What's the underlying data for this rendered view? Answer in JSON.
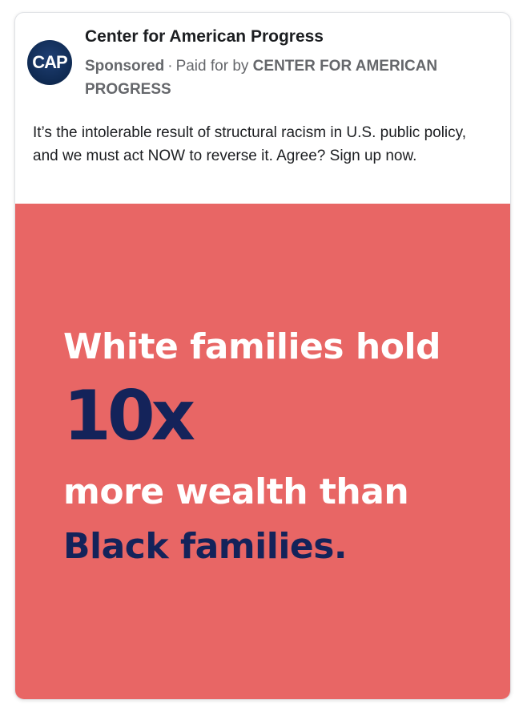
{
  "advertiser": {
    "name": "Center for American Progress",
    "avatar_text": "CAP",
    "sponsored_label": "Sponsored",
    "separator": "·",
    "paid_for_prefix": "Paid for by",
    "paid_for_entity": "CENTER FOR AMERICAN PROGRESS"
  },
  "post": {
    "text": "It’s the intolerable result of structural racism in U.S. public policy, and we must act NOW to reverse it. Agree? Sign up now."
  },
  "ad_image": {
    "line1": "White families hold",
    "line2": "10x",
    "line3": "more wealth than",
    "line4": "Black families.",
    "colors": {
      "background": "#e86665",
      "light_text": "#ffffff",
      "dark_text": "#14235a"
    }
  }
}
